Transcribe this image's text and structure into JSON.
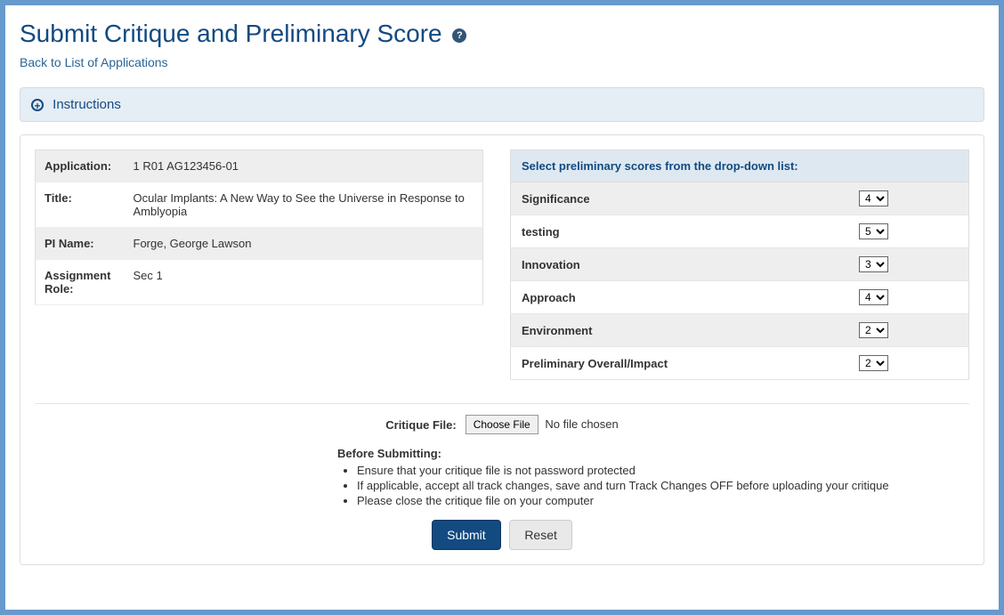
{
  "page_title": "Submit Critique and Preliminary Score",
  "back_link_text": "Back to List of Applications",
  "instructions_label": "Instructions",
  "app_info": {
    "labels": {
      "application": "Application:",
      "title": "Title:",
      "pi_name": "PI Name:",
      "assignment_role": "Assignment Role:"
    },
    "application": "1 R01 AG123456-01",
    "title": "Ocular Implants: A New Way to See the Universe in Response to Amblyopia",
    "pi_name": "Forge, George Lawson",
    "assignment_role": "Sec 1"
  },
  "scores_header": "Select preliminary scores from the drop-down list:",
  "score_rows": [
    {
      "label": "Significance",
      "value": "4"
    },
    {
      "label": "testing",
      "value": "5"
    },
    {
      "label": "Innovation",
      "value": "3"
    },
    {
      "label": "Approach",
      "value": "4"
    },
    {
      "label": "Environment",
      "value": "2"
    },
    {
      "label": "Preliminary Overall/Impact",
      "value": "2"
    }
  ],
  "critique_file": {
    "label": "Critique File:",
    "button_text": "Choose File",
    "status_text": "No file chosen"
  },
  "before_submitting": {
    "heading": "Before Submitting:",
    "items": [
      "Ensure that your critique file is not password protected",
      "If applicable, accept all track changes, save and turn Track Changes OFF before uploading your critique",
      "Please close the critique file on your computer"
    ]
  },
  "buttons": {
    "submit": "Submit",
    "reset": "Reset"
  }
}
